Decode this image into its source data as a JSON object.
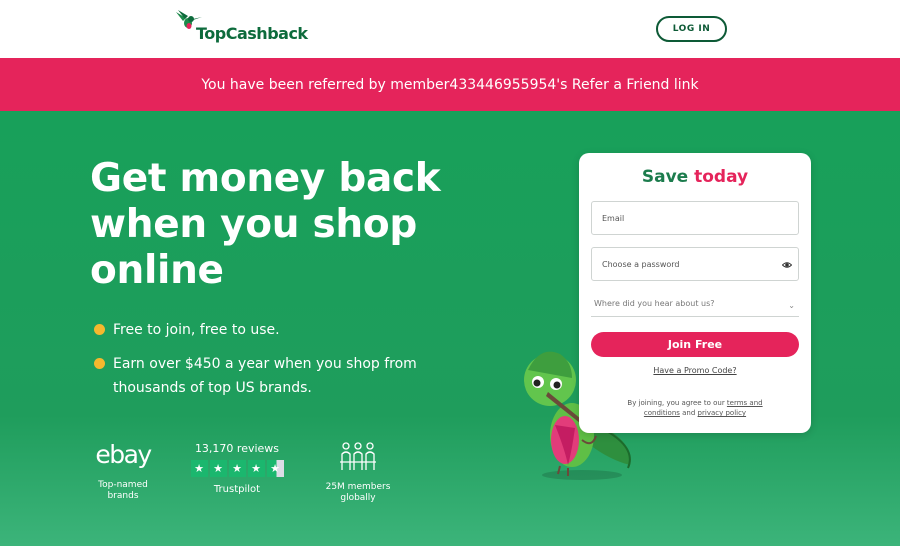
{
  "header": {
    "logo_text": "TopCashback",
    "login_label": "LOG IN"
  },
  "referral": {
    "text": "You have been referred by member433446955954's Refer a Friend link"
  },
  "hero": {
    "headline": "Get money back when you shop online",
    "bullets": [
      "Free to join, free to use.",
      "Earn over $450 a year when you shop from thousands of top US brands."
    ],
    "trust": {
      "ebay_logo": "ebay",
      "ebay_caption": "Top-named brands",
      "reviews": "13,170 reviews",
      "trustpilot": "Trustpilot",
      "members_caption": "25M members globally"
    }
  },
  "signup": {
    "title_part1": "Save ",
    "title_part2": "today",
    "email_placeholder": "Email",
    "password_placeholder": "Choose a password",
    "source_placeholder": "Where did you hear about us?",
    "join_label": "Join Free",
    "promo_link": "Have a Promo Code?",
    "terms_prefix": "By joining, you agree to our ",
    "terms_link": "terms and conditions",
    "terms_and": " and ",
    "privacy_link": "privacy policy"
  },
  "colors": {
    "green": "#1f9d5c",
    "pink": "#e5245b",
    "dark_green": "#0d5a36"
  },
  "icons": [
    "hummingbird-logo-icon",
    "star-icon",
    "people-icon",
    "eye-icon",
    "chevron-down-icon"
  ]
}
